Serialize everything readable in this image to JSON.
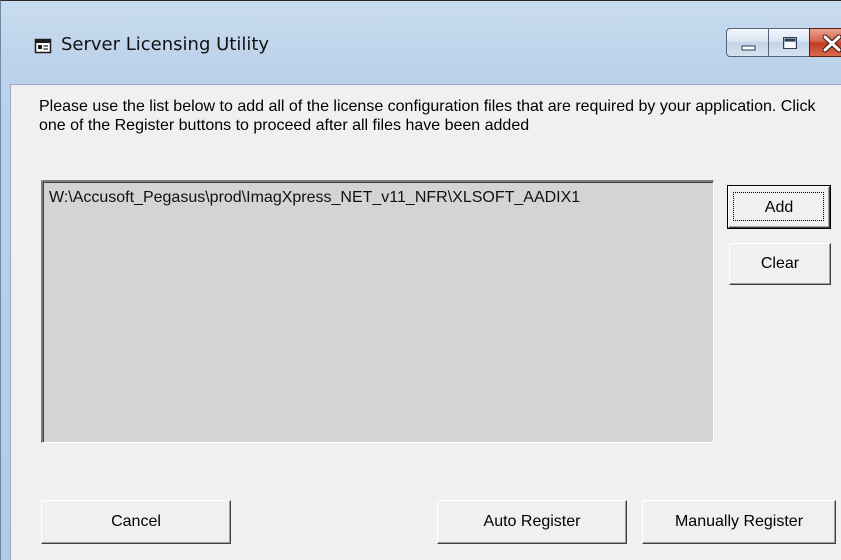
{
  "window": {
    "title": "Server Licensing Utility"
  },
  "title_buttons": {
    "minimize": "minimize-icon",
    "maximize": "maximize-icon",
    "close": "close-icon"
  },
  "main": {
    "instructions": "Please use the list below to add all of the license configuration files that are required by your application. Click one of the Register buttons to proceed after all files have been added",
    "files": [
      "W:\\Accusoft_Pegasus\\prod\\ImagXpress_NET_v11_NFR\\XLSOFT_AADIX1"
    ]
  },
  "buttons": {
    "add": "Add",
    "clear": "Clear",
    "cancel": "Cancel",
    "auto_register": "Auto Register",
    "manually_register": "Manually Register"
  },
  "colors": {
    "titlebar": "#bcd2ea",
    "client_background": "#f0f0f0",
    "list_background": "#d4d4d4",
    "close_button": "#c13b20"
  }
}
